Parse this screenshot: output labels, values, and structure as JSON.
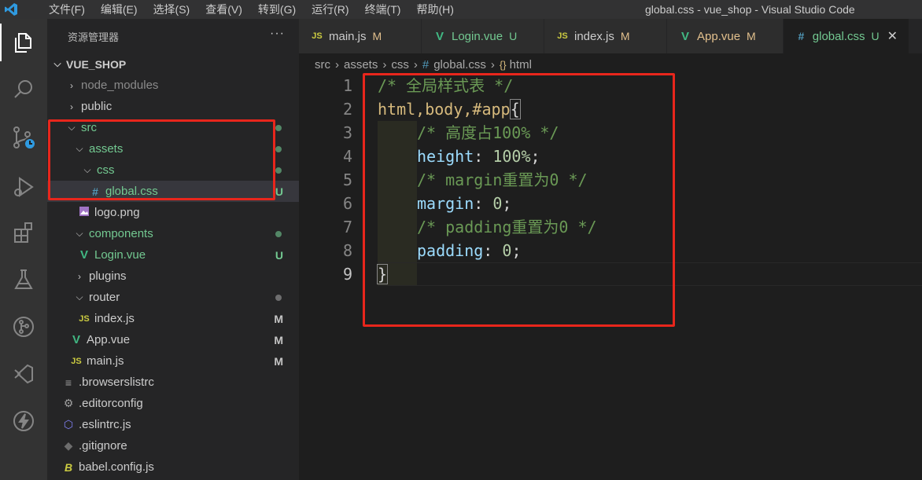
{
  "menu": {
    "items": [
      "文件(F)",
      "编辑(E)",
      "选择(S)",
      "查看(V)",
      "转到(G)",
      "运行(R)",
      "终端(T)",
      "帮助(H)"
    ]
  },
  "window_title": "global.css - vue_shop - Visual Studio Code",
  "activity_bar": {
    "icons": [
      "explorer-icon",
      "search-icon",
      "source-control-icon",
      "run-debug-icon",
      "extensions-icon",
      "testing-icon",
      "git-graph-icon",
      "live-share-icon",
      "lightning-icon"
    ]
  },
  "explorer": {
    "title": "资源管理器",
    "more": "···",
    "project": "VUE_SHOP",
    "items": [
      {
        "label": "node_modules",
        "badge": ""
      },
      {
        "label": "public",
        "badge": ""
      },
      {
        "label": "src",
        "badge": ""
      },
      {
        "label": "assets",
        "badge": ""
      },
      {
        "label": "css",
        "badge": ""
      },
      {
        "label": "global.css",
        "badge": "U",
        "icon": "#"
      },
      {
        "label": "logo.png",
        "badge": ""
      },
      {
        "label": "components",
        "badge": ""
      },
      {
        "label": "Login.vue",
        "badge": "U",
        "icon": "V"
      },
      {
        "label": "plugins",
        "badge": ""
      },
      {
        "label": "router",
        "badge": ""
      },
      {
        "label": "index.js",
        "badge": "M",
        "icon": "JS"
      },
      {
        "label": "App.vue",
        "badge": "M",
        "icon": "V"
      },
      {
        "label": "main.js",
        "badge": "M",
        "icon": "JS"
      },
      {
        "label": ".browserslistrc",
        "badge": ""
      },
      {
        "label": ".editorconfig",
        "badge": ""
      },
      {
        "label": ".eslintrc.js",
        "badge": ""
      },
      {
        "label": ".gitignore",
        "badge": ""
      },
      {
        "label": "babel.config.js",
        "badge": ""
      }
    ]
  },
  "tabs": [
    {
      "icon": "JS",
      "label": "main.js",
      "badge": "M"
    },
    {
      "icon": "V",
      "label": "Login.vue",
      "badge": "U"
    },
    {
      "icon": "JS",
      "label": "index.js",
      "badge": "M"
    },
    {
      "icon": "V",
      "label": "App.vue",
      "badge": "M"
    },
    {
      "icon": "#",
      "label": "global.css",
      "badge": "U",
      "close": "✕"
    }
  ],
  "breadcrumbs": [
    "src",
    "assets",
    "css",
    "global.css",
    "html"
  ],
  "editor": {
    "line_numbers": [
      "1",
      "2",
      "3",
      "4",
      "5",
      "6",
      "7",
      "8",
      "9"
    ],
    "lines": {
      "l1": "/* 全局样式表 */",
      "l2_sel": "html,body,#app",
      "l2_brace": "{",
      "l3": "/* 高度占100% */",
      "l4_prop": "height",
      "l4_colon": ": ",
      "l4_val": "100%",
      "l4_semi": ";",
      "l5": "/* margin重置为0 */",
      "l6_prop": "margin",
      "l6_colon": ": ",
      "l6_val": "0",
      "l6_semi": ";",
      "l7": "/* padding重置为0 */",
      "l8_prop": "padding",
      "l8_colon": ": ",
      "l8_val": "0",
      "l8_semi": ";",
      "l9": "}"
    }
  },
  "colors": {
    "annotation_red": "#e8261c",
    "untracked_green": "#73c991",
    "modified_yellow": "#e2c08d"
  }
}
